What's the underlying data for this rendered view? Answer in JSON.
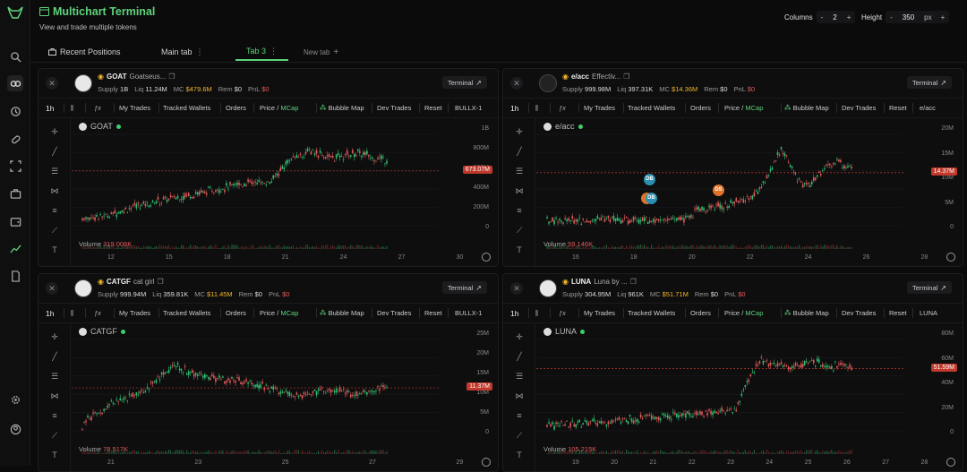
{
  "header": {
    "title": "Multichart Terminal",
    "subtitle": "View and trade multiple tokens",
    "columns_label": "Columns",
    "columns_value": "2",
    "height_label": "Height",
    "height_value": "350",
    "height_unit": "px",
    "minus": "-",
    "plus": "+"
  },
  "tabs": {
    "recent": "Recent Positions",
    "main": "Main tab",
    "tab3": "Tab 3",
    "new": "New tab",
    "dots": "⋮",
    "plus": "+"
  },
  "toolbar": {
    "interval": "1h",
    "my_trades": "My Trades",
    "tracked": "Tracked Wallets",
    "orders": "Orders",
    "price": "Price",
    "slash": "/",
    "mcap": "MCap",
    "bubble": "Bubble Map",
    "dev": "Dev Trades",
    "reset": "Reset"
  },
  "stat_labels": {
    "supply": "Supply",
    "liq": "Liq",
    "mc": "MC",
    "rem": "Rem",
    "pnl": "PnL"
  },
  "terminal_label": "Terminal",
  "volume_label": "Volume",
  "panels": [
    {
      "name": "GOAT",
      "desc": "Goatseus...",
      "supply": "1B",
      "liq": "11.24M",
      "mc": "$479.6M",
      "rem": "$0",
      "pnl": "$0",
      "pair": "BULLX-1",
      "sym": "GOAT",
      "volume": "319.006K",
      "price_label": "673.07M",
      "yticks": [
        "1B",
        "800M",
        "600M",
        "400M",
        "200M",
        "0"
      ],
      "xticks": [
        "12",
        "15",
        "18",
        "21",
        "24",
        "27",
        "30"
      ],
      "markers": []
    },
    {
      "name": "e/acc",
      "desc": "Effectiv...",
      "supply": "999.98M",
      "liq": "397.31K",
      "mc": "$14.36M",
      "rem": "$0",
      "pnl": "$0",
      "pair": "e/acc",
      "sym": "e/acc",
      "volume": "59.146K",
      "price_label": "14.37M",
      "yticks": [
        "20M",
        "15M",
        "10M",
        "5M",
        "0"
      ],
      "xticks": [
        "16",
        "18",
        "20",
        "22",
        "24",
        "26",
        "28"
      ],
      "markers": [
        "DB",
        "DB",
        "DS"
      ]
    },
    {
      "name": "CATGF",
      "desc": "cat girl",
      "supply": "999.94M",
      "liq": "359.81K",
      "mc": "$11.45M",
      "rem": "$0",
      "pnl": "$0",
      "pair": "BULLX-1",
      "sym": "CATGF",
      "volume": "78.517K",
      "price_label": "11.37M",
      "yticks": [
        "25M",
        "20M",
        "15M",
        "10M",
        "5M",
        "0"
      ],
      "xticks": [
        "21",
        "23",
        "25",
        "27",
        "29"
      ],
      "markers": []
    },
    {
      "name": "LUNA",
      "desc": "Luna by ...",
      "supply": "304.95M",
      "liq": "961K",
      "mc": "$51.71M",
      "rem": "$0",
      "pnl": "$0",
      "pair": "LUNA",
      "sym": "LUNA",
      "volume": "105.215K",
      "price_label": "51.59M",
      "yticks": [
        "80M",
        "60M",
        "40M",
        "20M",
        "0"
      ],
      "xticks": [
        "19",
        "20",
        "21",
        "22",
        "23",
        "24",
        "25",
        "26",
        "27",
        "28"
      ],
      "markers": []
    }
  ],
  "colors": {
    "accent": "#5fd37a",
    "up": "#2fbf71",
    "down": "#e05a5a",
    "price_tag": "#c0392b"
  }
}
